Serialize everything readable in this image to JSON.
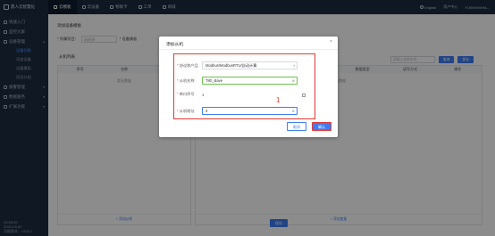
{
  "topbar": {
    "brand": "鼎人云智慧化",
    "tabs": [
      {
        "label": "云模板",
        "active": true
      },
      {
        "label": "云设备",
        "active": false
      },
      {
        "label": "物联卡",
        "active": false
      },
      {
        "label": "工单",
        "active": false
      },
      {
        "label": "商城",
        "active": false
      }
    ],
    "language": "English",
    "user_center": "用户中心",
    "account": "YUSHIXINHA..."
  },
  "sidebar": {
    "items": [
      {
        "label": "快速入门"
      },
      {
        "label": "监控大屏"
      },
      {
        "label": "设备管理",
        "expanded": true
      },
      {
        "label": "报警管理"
      },
      {
        "label": "数据服务"
      },
      {
        "label": "扩展功能"
      }
    ],
    "subitems": [
      {
        "label": "设备列表",
        "active": true
      },
      {
        "label": "添加设备",
        "active": false
      },
      {
        "label": "设备模板",
        "active": false
      },
      {
        "label": "项目分组",
        "active": false
      }
    ],
    "footer": {
      "time": "20:58:49",
      "date": "2020-03-02",
      "version": "功能版本：V3.6.2"
    }
  },
  "content": {
    "breadcrumb": "添加设备模板",
    "filter1_label": "* 所属项目：",
    "filter1_placeholder": "请选择",
    "filter2_label": "* 设备模板",
    "section_title": "从机列表",
    "search_placeholder": "请输入变量名称",
    "search_button": "查询",
    "add_button": "保存",
    "left_table": {
      "headers": [
        "序号",
        "名称",
        "操作"
      ],
      "empty": "暂无数据",
      "add": "+ 添加从机"
    },
    "right_table": {
      "headers": [
        "序号",
        "变量名称",
        "寄存器",
        "数据类型",
        "读写方式",
        "操作"
      ],
      "empty": "暂无数据",
      "add": "+ 添加变量"
    },
    "save_button": "保存"
  },
  "modal": {
    "title": "添加从机",
    "close": "×",
    "fields": {
      "protocol_label": "协议和产品",
      "protocol_value": "Modbus/ModbusRTU/自动计算",
      "name_label": "从机名称",
      "name_value": "780_slave",
      "serial_label": "串口序号",
      "serial_value": "1",
      "address_label": "从机地址",
      "address_value": "3"
    },
    "annotation": "1",
    "cancel": "取消",
    "confirm": "确认"
  },
  "colors": {
    "accent": "#3d7cf4",
    "highlight": "#e53935",
    "topbar": "#1a2a3f",
    "sidebar": "#1e2d42"
  }
}
